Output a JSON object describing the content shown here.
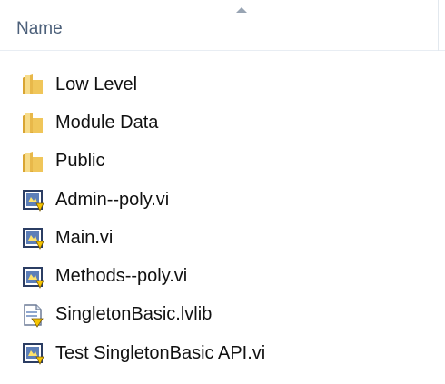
{
  "header": {
    "column_name": "Name"
  },
  "files": [
    {
      "name": "Low Level",
      "icon": "folder-icon"
    },
    {
      "name": "Module Data",
      "icon": "folder-icon"
    },
    {
      "name": "Public",
      "icon": "folder-icon"
    },
    {
      "name": "Admin--poly.vi",
      "icon": "vi-file-icon"
    },
    {
      "name": "Main.vi",
      "icon": "vi-file-icon"
    },
    {
      "name": "Methods--poly.vi",
      "icon": "vi-file-icon"
    },
    {
      "name": "SingletonBasic.lvlib",
      "icon": "lvlib-file-icon"
    },
    {
      "name": "Test SingletonBasic API.vi",
      "icon": "vi-file-icon"
    }
  ],
  "colors": {
    "folder": "#e8b84a",
    "header_text": "#4c607a"
  }
}
